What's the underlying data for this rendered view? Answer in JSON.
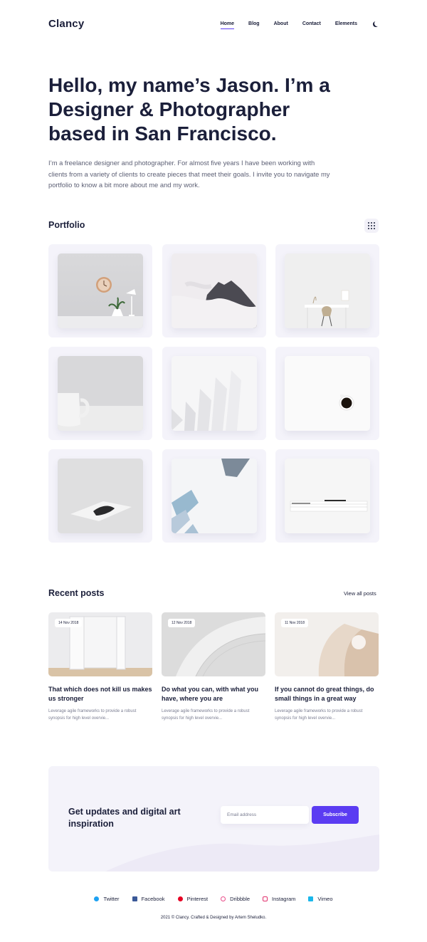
{
  "header": {
    "logo": "Clancy",
    "nav": [
      {
        "label": "Home",
        "active": true
      },
      {
        "label": "Blog",
        "active": false
      },
      {
        "label": "About",
        "active": false
      },
      {
        "label": "Contact",
        "active": false
      },
      {
        "label": "Elements",
        "active": false
      }
    ],
    "theme_toggle_icon": "moon-icon"
  },
  "hero": {
    "title": "Hello, my name’s Jason. I’m a Designer & Photographer based in San Francisco.",
    "description": "I’m a freelance designer and photographer. For almost five years I have been working with clients from a variety of clients to create pieces that meet their goals. I invite you to navigate my portfolio to know a bit more about me and my work."
  },
  "portfolio": {
    "title": "Portfolio",
    "grid_icon": "grid-icon",
    "items": [
      "wall-clock-desk-lamp-plant",
      "mountain-in-clouds",
      "white-desk-chair",
      "white-coffee-mug",
      "white-architecture-fins",
      "black-coffee-cup-top-view",
      "book-on-white-surface",
      "skyscrapers-looking-up",
      "stacked-magazines"
    ]
  },
  "recent_posts": {
    "title": "Recent posts",
    "view_all": "View all posts",
    "posts": [
      {
        "date": "14 Nov 2018",
        "title": "That which does not kill us makes us stronger",
        "excerpt": "Leverage agile frameworks to provide a robust synopsis for high level overvie..."
      },
      {
        "date": "12 Nov 2018",
        "title": "Do what you can, with what you have, where you are",
        "excerpt": "Leverage agile frameworks to provide a robust synopsis for high level overvie..."
      },
      {
        "date": "11 Nov 2018",
        "title": "If you cannot do great things, do small things in a great way",
        "excerpt": "Leverage agile frameworks to provide a robust synopsis for high level overvie..."
      }
    ]
  },
  "newsletter": {
    "title": "Get updates and digital art inspiration",
    "email_placeholder": "Email address",
    "button": "Subscribe"
  },
  "footer": {
    "social": [
      {
        "label": "Twitter",
        "icon": "twitter-icon",
        "color": "#1da1f2"
      },
      {
        "label": "Facebook",
        "icon": "facebook-icon",
        "color": "#3b5998"
      },
      {
        "label": "Pinterest",
        "icon": "pinterest-icon",
        "color": "#e60023"
      },
      {
        "label": "Dribbble",
        "icon": "dribbble-icon",
        "color": "#ea4c89"
      },
      {
        "label": "Instagram",
        "icon": "instagram-icon",
        "color": "#e1306c"
      },
      {
        "label": "Vimeo",
        "icon": "vimeo-icon",
        "color": "#1ab7ea"
      }
    ],
    "copyright": "2021 © Clancy. Crafted & Designed by Artem Sheludko."
  },
  "colors": {
    "accent": "#5b3cf2",
    "text": "#1b1f3a",
    "muted": "#5d6075",
    "card_bg": "#f4f3fa"
  }
}
